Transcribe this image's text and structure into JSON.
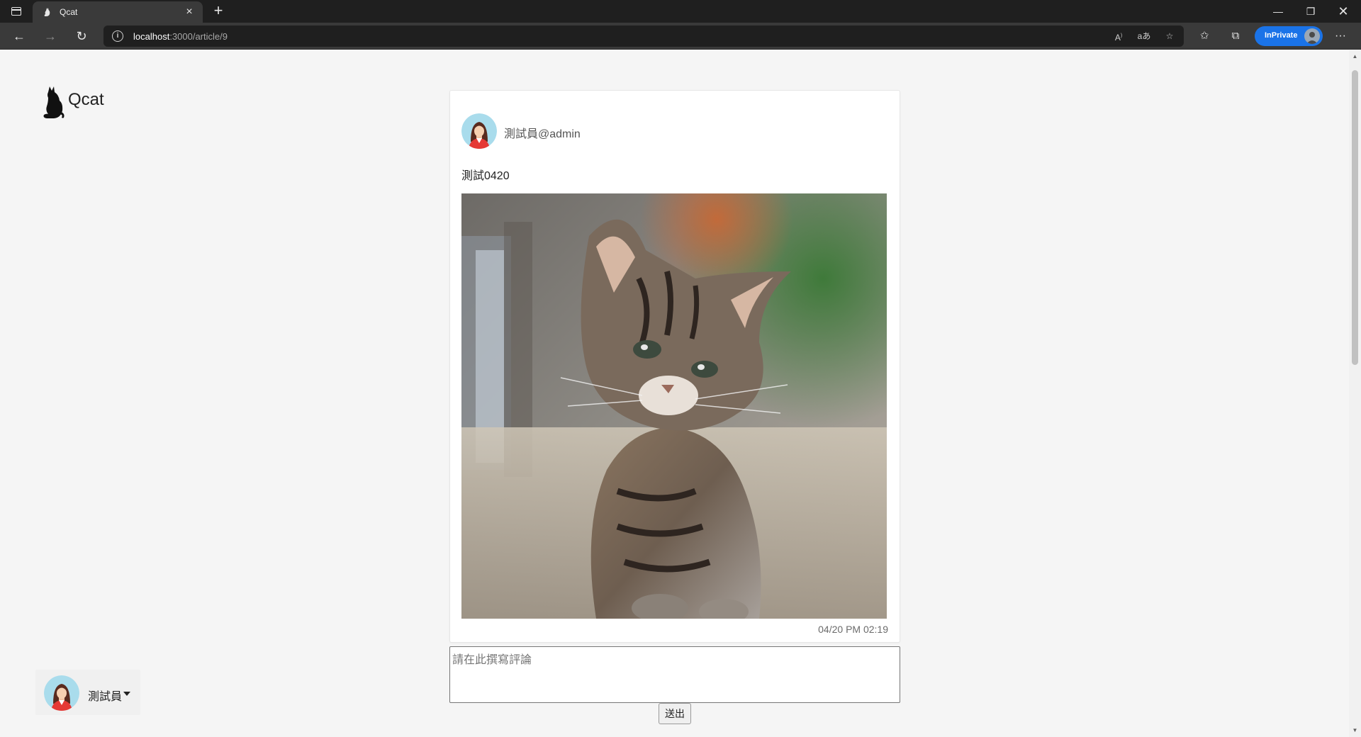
{
  "browser": {
    "tab_title": "Qcat",
    "url_host": "localhost",
    "url_path": ":3000/article/9",
    "inprivate_label": "InPrivate",
    "accent_color": "#1a73e8"
  },
  "icons": {
    "tab_actions": "tab-actions-icon",
    "back": "arrow-left-icon",
    "forward": "arrow-right-icon",
    "refresh": "refresh-icon",
    "read_aloud": "read-aloud-icon",
    "translate": "translate-icon",
    "add_favorite": "star-plus-icon",
    "favorites": "favorites-icon",
    "collections": "collections-icon",
    "more": "ellipsis-icon"
  },
  "brand": {
    "name": "Qcat",
    "logo_icon": "cat-silhouette-icon"
  },
  "post": {
    "author": "測試員@admin",
    "text": "測試0420",
    "image_alt": "tabby kitten photo",
    "timestamp": "04/20 PM 02:19"
  },
  "comment": {
    "placeholder": "請在此撰寫評論",
    "submit_label": "送出"
  },
  "user_menu": {
    "name": "測試員"
  }
}
